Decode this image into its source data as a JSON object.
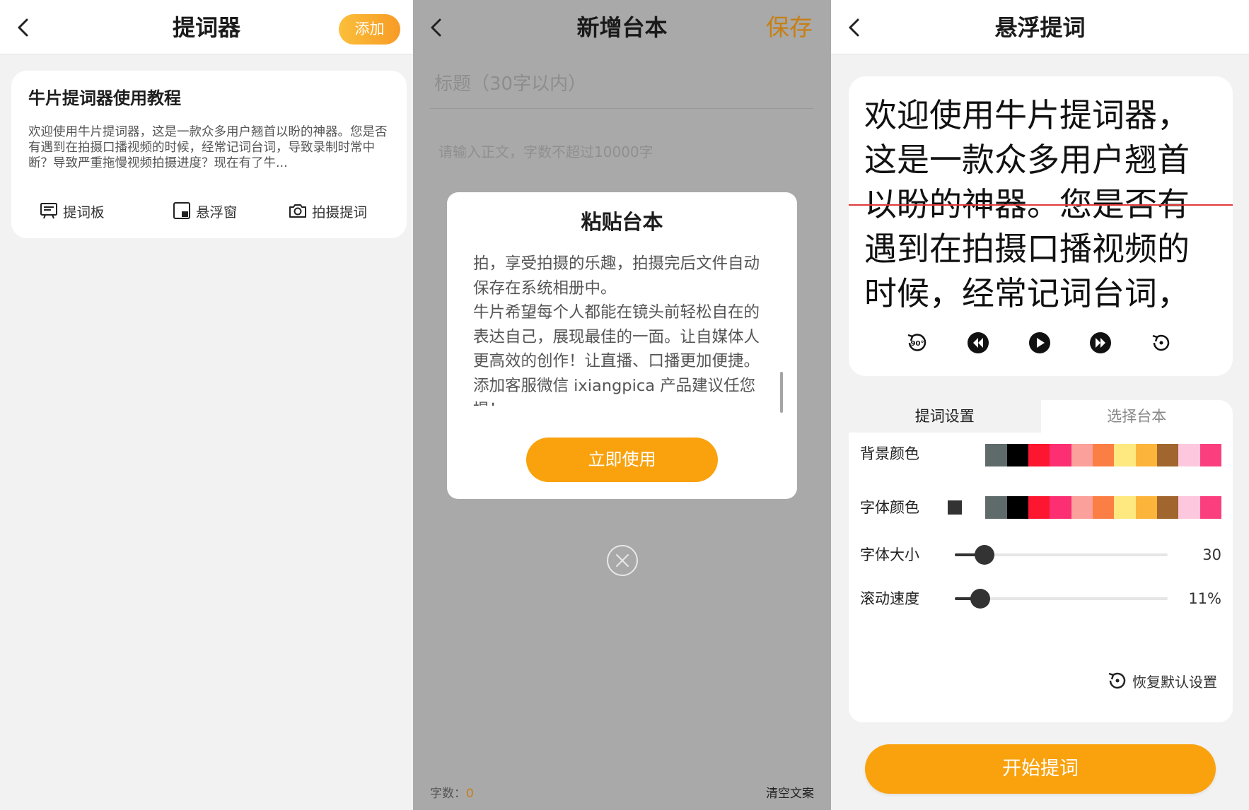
{
  "panel1": {
    "title": "提词器",
    "add_label": "添加",
    "card": {
      "title": "牛片提词器使用教程",
      "body": "欢迎使用牛片提词器，这是一款众多用户翘首以盼的神器。您是否有遇到在拍摄口播视频的时候，经常记词台词，导致录制时常中断？导致严重拖慢视频拍摄进度？现在有了牛...",
      "actions": [
        {
          "label": "提词板",
          "icon": "board-icon"
        },
        {
          "label": "悬浮窗",
          "icon": "float-window-icon"
        },
        {
          "label": "拍摄提词",
          "icon": "camera-icon"
        }
      ]
    }
  },
  "panel2": {
    "title": "新增台本",
    "save_label": "保存",
    "title_placeholder": "标题（30字以内）",
    "body_placeholder": "请输入正文，字数不超过10000字",
    "modal": {
      "title": "粘贴台本",
      "text": "拍，享受拍摄的乐趣，拍摄完后文件自动保存在系统相册中。\n牛片希望每个人都能在镜头前轻松自在的表达自己，展现最佳的一面。让自媒体人更高效的创作！让直播、口播更加便捷。添加客服微信 ixiangpica 产品建议任您提！",
      "use_label": "立即使用"
    },
    "count_label": "字数：",
    "count_value": "0",
    "clear_label": "清空文案"
  },
  "panel3": {
    "title": "悬浮提词",
    "preview_text": "欢迎使用牛片提词器，这是一款众多用户翘首以盼的神器。您是否有遇到在拍摄口播视频的时候，经常记词台词，",
    "rotate_label": "90°",
    "tabs": [
      "提词设置",
      "选择台本"
    ],
    "bg_color_label": "背景颜色",
    "font_color_label": "字体颜色",
    "font_size_label": "字体大小",
    "font_size_value": "30",
    "font_size_fraction": 0.14,
    "scroll_speed_label": "滚动速度",
    "scroll_speed_value": "11%",
    "scroll_speed_fraction": 0.12,
    "reset_label": "恢复默认设置",
    "start_label": "开始提词",
    "swatch_colors": [
      "#ffffff",
      "#5e6b6a",
      "#000000",
      "#fd1630",
      "#fb2f72",
      "#fca09b",
      "#fb7f44",
      "#fde97f",
      "#fdb43a",
      "#a0662e",
      "#fdc7de",
      "#fb3f7e"
    ],
    "font_color_current": "#333333"
  }
}
